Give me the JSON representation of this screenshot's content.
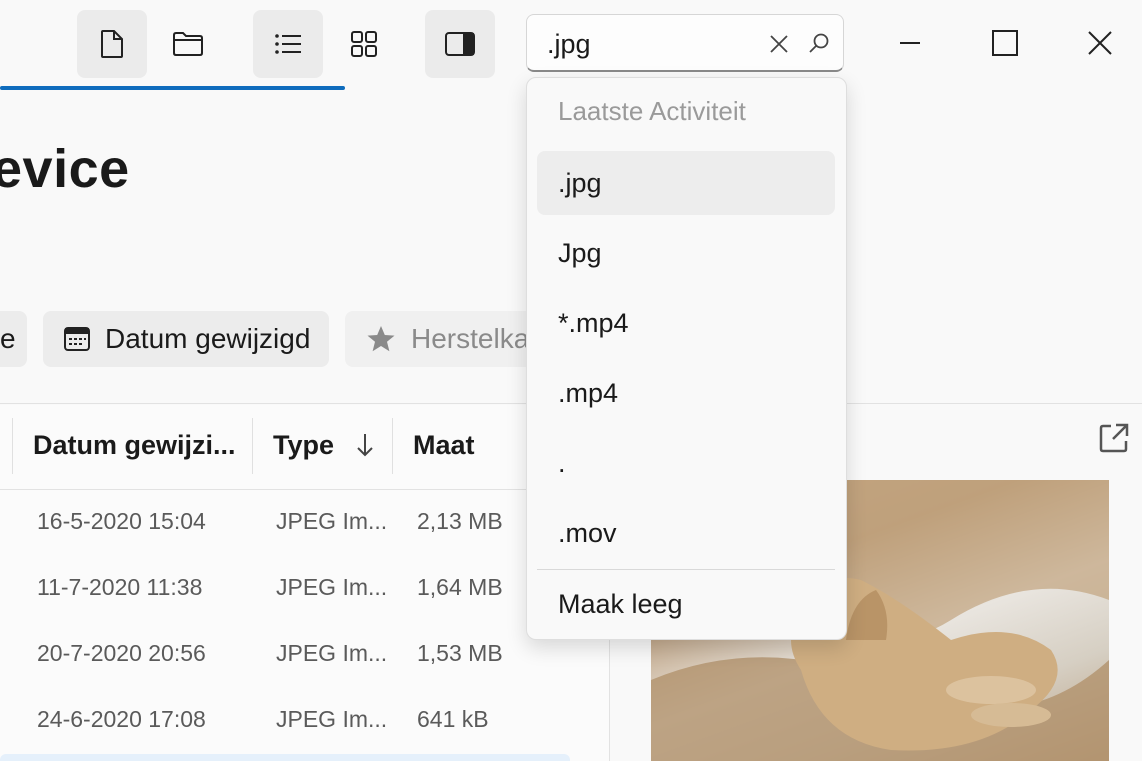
{
  "header": {
    "title_fragment": "evice",
    "progress_fraction": 0.3
  },
  "toolbar": {
    "icons": [
      "new-file-icon",
      "folder-icon",
      "list-view-icon",
      "grid-view-icon",
      "details-pane-icon"
    ]
  },
  "search": {
    "value": ".jpg",
    "clear_icon": "close-icon",
    "search_icon": "search-icon"
  },
  "suggestions": {
    "header": "Laatste Activiteit",
    "items": [
      ".jpg",
      "Jpg",
      "*.mp4",
      ".mp4",
      ".",
      ".mov"
    ],
    "clear_label": "Maak leeg"
  },
  "filters": {
    "partial_label": "e",
    "date_label": "Datum gewijzigd",
    "partial_restore_label": "Herstelka"
  },
  "columns": {
    "date": "Datum gewijzi...",
    "type": "Type",
    "size": "Maat",
    "sort_icon": "arrow-down-icon"
  },
  "rows": [
    {
      "date": "16-5-2020 15:04",
      "type": "JPEG Im...",
      "size": "2,13 MB"
    },
    {
      "date": "11-7-2020 11:38",
      "type": "JPEG Im...",
      "size": "1,64 MB"
    },
    {
      "date": "20-7-2020 20:56",
      "type": "JPEG Im...",
      "size": "1,53 MB"
    },
    {
      "date": "24-6-2020 17:08",
      "type": "JPEG Im...",
      "size": "641 kB"
    }
  ],
  "colors": {
    "accent": "#0f6cbd",
    "selected_row": "#e5f0fb"
  }
}
